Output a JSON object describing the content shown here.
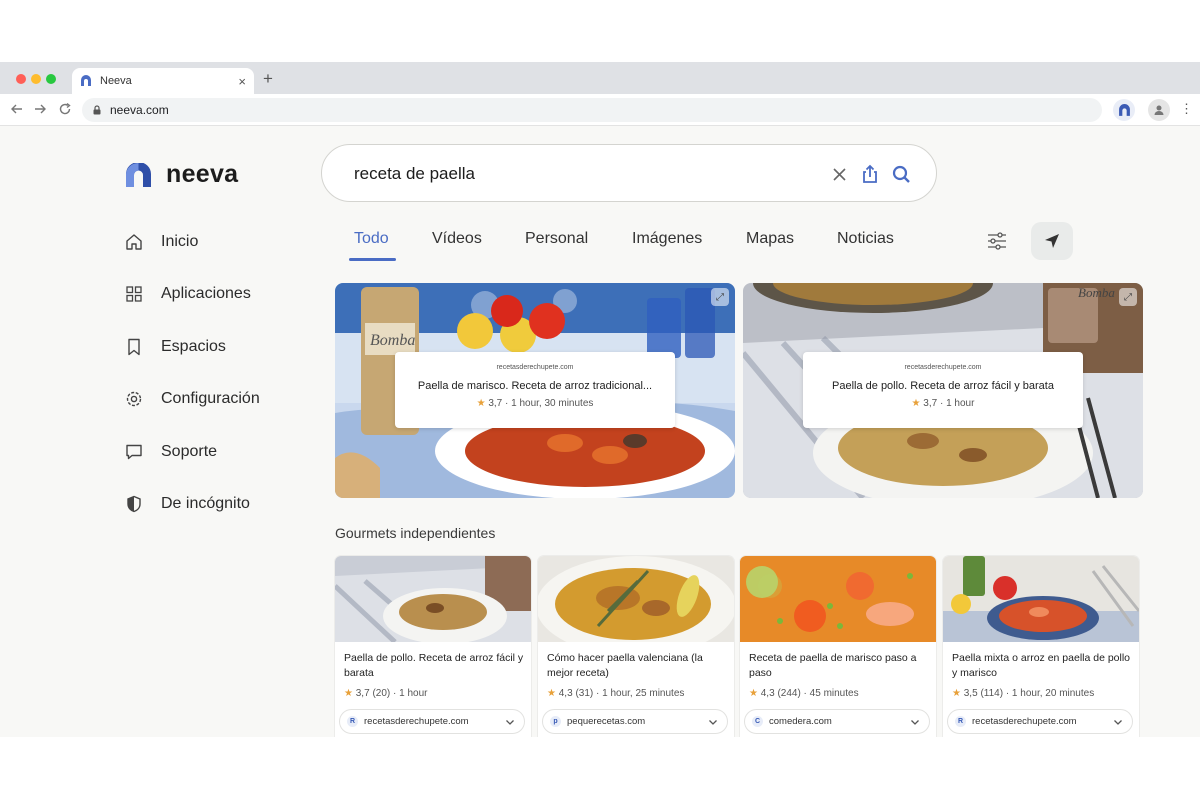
{
  "browser": {
    "tab_title": "Neeva",
    "new_tab_symbol": "+",
    "url": "neeva.com",
    "close_symbol": "×",
    "menu_symbol": "⋮"
  },
  "logo_text": "neeva",
  "search": {
    "query": "receta de paella"
  },
  "sidebar": {
    "items": [
      {
        "label": "Inicio",
        "icon": "home-icon"
      },
      {
        "label": "Aplicaciones",
        "icon": "apps-grid-icon"
      },
      {
        "label": "Espacios",
        "icon": "bookmark-icon"
      },
      {
        "label": "Configuración",
        "icon": "gear-icon"
      },
      {
        "label": "Soporte",
        "icon": "chat-bubble-icon"
      },
      {
        "label": "De incógnito",
        "icon": "shield-icon"
      }
    ]
  },
  "tabs": [
    "Todo",
    "Vídeos",
    "Personal",
    "Imágenes",
    "Mapas",
    "Noticias"
  ],
  "active_tab": "Todo",
  "hero_cards": [
    {
      "source": "recetasderechupete.com",
      "title": "Paella de marisco. Receta de arroz tradicional...",
      "rating": "3,7",
      "meta": "· 1 hour, 30 minutes"
    },
    {
      "source": "recetasderechupete.com",
      "title": "Paella de pollo. Receta de arroz fácil y barata",
      "rating": "3,7",
      "meta": "· 1 hour"
    }
  ],
  "section_title": "Gourmets independientes",
  "cards": [
    {
      "title": "Paella de pollo. Receta de arroz fácil y barata",
      "rating": "3,7",
      "meta": "(20) · 1 hour",
      "source": "recetasderechupete.com",
      "favicon": "R"
    },
    {
      "title": "Cómo hacer paella valenciana (la mejor receta)",
      "rating": "4,3",
      "meta": "(31) · 1 hour, 25 minutes",
      "source": "pequerecetas.com",
      "favicon": "p"
    },
    {
      "title": "Receta de paella de marisco paso a paso",
      "rating": "4,3",
      "meta": "(244) · 45 minutes",
      "source": "comedera.com",
      "favicon": "C"
    },
    {
      "title": "Paella mixta o arroz en paella de pollo y marisco",
      "rating": "3,5",
      "meta": "(114) · 1 hour, 20 minutes",
      "source": "recetasderechupete.com",
      "favicon": "R"
    }
  ],
  "colors": {
    "accent": "#4a6cc4",
    "star": "#e8a13a",
    "page_bg": "#f8f8f6"
  }
}
